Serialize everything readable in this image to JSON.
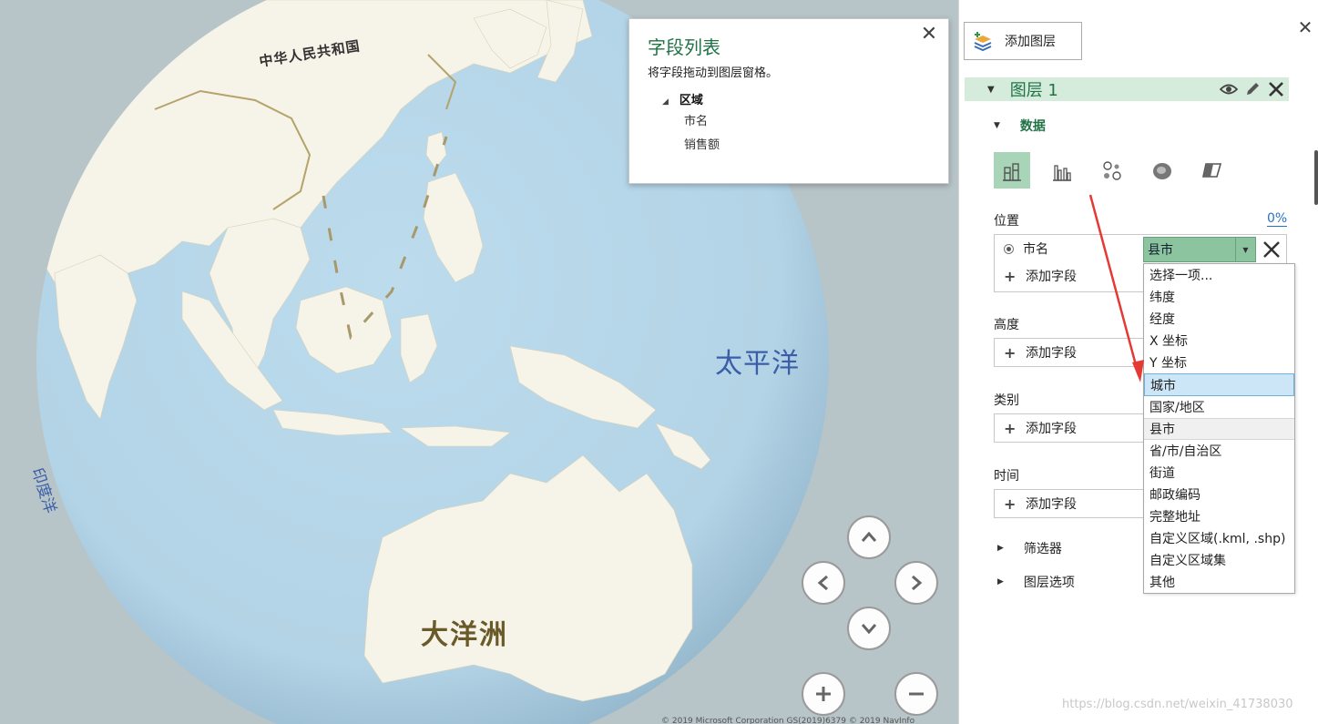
{
  "map": {
    "labels": {
      "china": "中华人民共和国",
      "pacific": "太平洋",
      "indian": "印度洋",
      "oceania": "大洋洲"
    },
    "copyright": "© 2019 Microsoft Corporation  GS(2019)6379  © 2019 NavInfo",
    "watermark": "https://blog.csdn.net/weixin_41738030",
    "colors": {
      "ocean": "#b9d8ea",
      "land": "#f6f3e8",
      "border": "#b0a070"
    }
  },
  "field_list": {
    "title": "字段列表",
    "hint": "将字段拖动到图层窗格。",
    "group": "区域",
    "items": [
      "市名",
      "销售额"
    ],
    "close": "✕"
  },
  "nav": {
    "up": "up-arrow",
    "left": "left-arrow",
    "right": "right-arrow",
    "down": "down-arrow",
    "zoom_in": "plus",
    "zoom_out": "minus"
  },
  "panel": {
    "close": "✕",
    "add_layer": "添加图层",
    "layer_name": "图层 1",
    "data_section": "数据",
    "position": {
      "label": "位置",
      "percent": "0%",
      "field": "市名",
      "geo_type": "县市",
      "add_field": "添加字段"
    },
    "height": {
      "label": "高度",
      "add_field": "添加字段"
    },
    "category": {
      "label": "类别",
      "add_field": "添加字段"
    },
    "time": {
      "label": "时间",
      "add_field": "添加字段"
    },
    "filters": "筛选器",
    "layer_options": "图层选项",
    "dropdown": [
      "选择一项...",
      "纬度",
      "经度",
      "X 坐标",
      "Y 坐标",
      "城市",
      "国家/地区",
      "县市",
      "省/市/自治区",
      "街道",
      "邮政编码",
      "完整地址",
      "自定义区域(.kml, .shp)",
      "自定义区域集",
      "其他"
    ],
    "dropdown_hovered": "城市",
    "dropdown_selected": "县市",
    "accent": "#217346"
  }
}
